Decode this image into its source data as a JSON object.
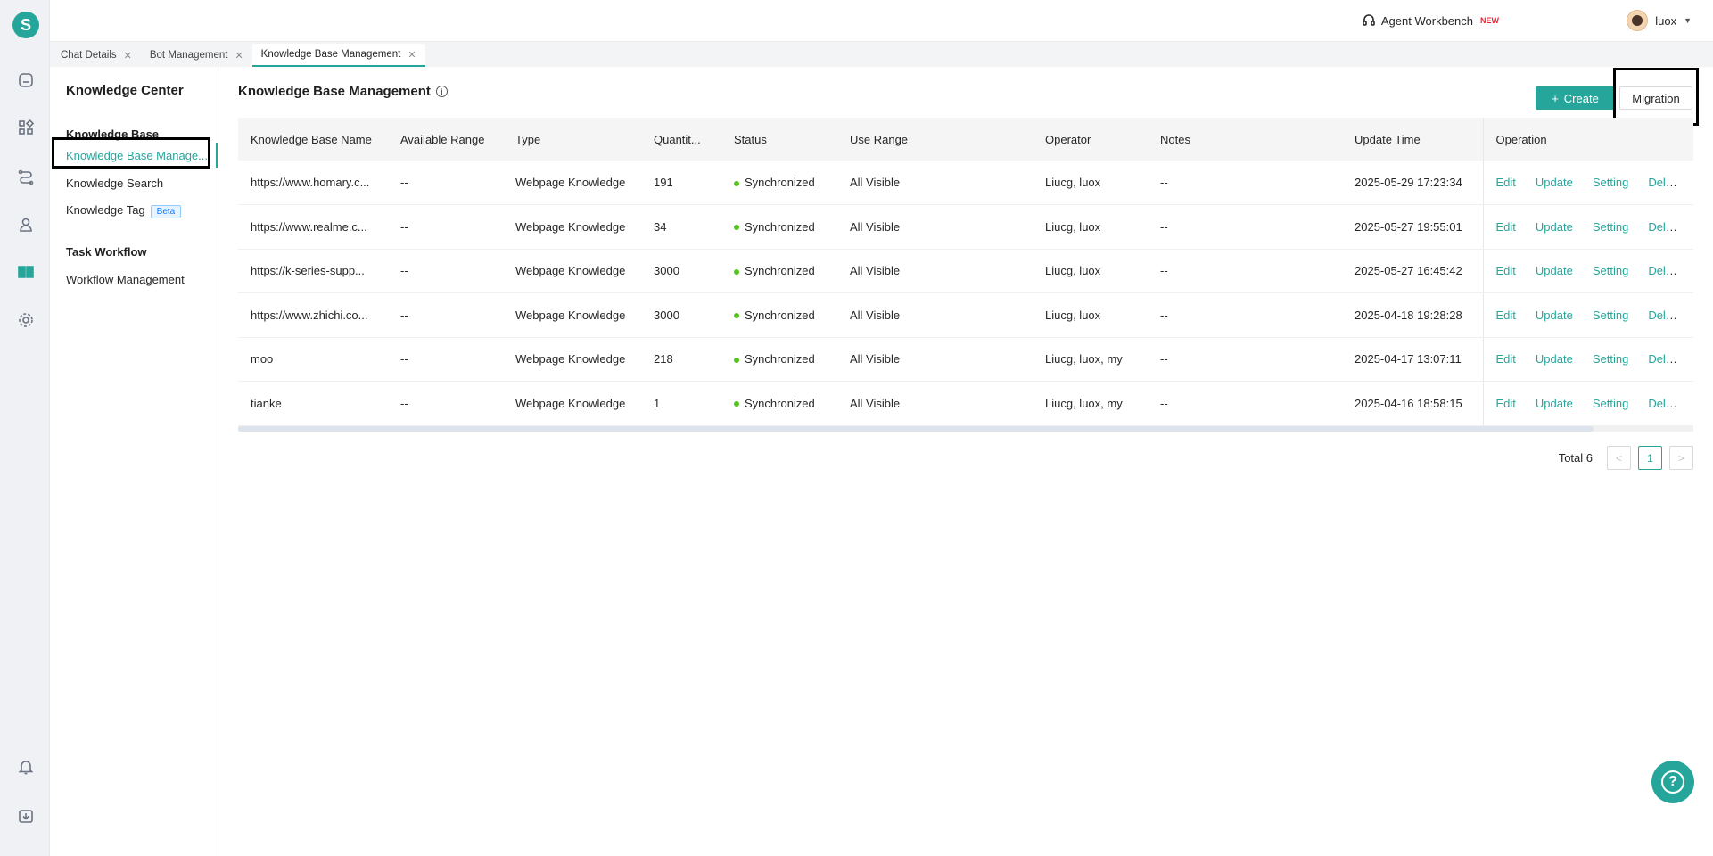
{
  "app": {
    "logo_letter": "S"
  },
  "header": {
    "agent_label": "Agent Workbench",
    "agent_badge": "NEW",
    "user_name": "luox"
  },
  "tabs": [
    {
      "label": "Chat Details"
    },
    {
      "label": "Bot Management"
    },
    {
      "label": "Knowledge Base Management"
    }
  ],
  "sidebar": {
    "title": "Knowledge Center",
    "group1": "Knowledge Base",
    "item1": "Knowledge Base Manage...",
    "item2": "Knowledge Search",
    "item3": "Knowledge Tag",
    "item3_badge": "Beta",
    "group2": "Task Workflow",
    "item4": "Workflow Management"
  },
  "main": {
    "title": "Knowledge Base Management",
    "create_label": "Create",
    "migration_label": "Migration",
    "columns": [
      "Knowledge Base Name",
      "Available Range",
      "Type",
      "Quantit...",
      "Status",
      "Use Range",
      "Operator",
      "Notes",
      "Update Time",
      "Operation"
    ],
    "rows": [
      {
        "name": "https://www.homary.c...",
        "range": "--",
        "type": "Webpage Knowledge",
        "qty": "191",
        "status": "Synchronized",
        "use": "All Visible",
        "operator": "Liucg, luox",
        "notes": "--",
        "time": "2025-05-29 17:23:34"
      },
      {
        "name": "https://www.realme.c...",
        "range": "--",
        "type": "Webpage Knowledge",
        "qty": "34",
        "status": "Synchronized",
        "use": "All Visible",
        "operator": "Liucg, luox",
        "notes": "--",
        "time": "2025-05-27 19:55:01"
      },
      {
        "name": "https://k-series-supp...",
        "range": "--",
        "type": "Webpage Knowledge",
        "qty": "3000",
        "status": "Synchronized",
        "use": "All Visible",
        "operator": "Liucg, luox",
        "notes": "--",
        "time": "2025-05-27 16:45:42"
      },
      {
        "name": "https://www.zhichi.co...",
        "range": "--",
        "type": "Webpage Knowledge",
        "qty": "3000",
        "status": "Synchronized",
        "use": "All Visible",
        "operator": "Liucg, luox",
        "notes": "--",
        "time": "2025-04-18 19:28:28"
      },
      {
        "name": "moo",
        "range": "--",
        "type": "Webpage Knowledge",
        "qty": "218",
        "status": "Synchronized",
        "use": "All Visible",
        "operator": "Liucg, luox, my",
        "notes": "--",
        "time": "2025-04-17 13:07:11"
      },
      {
        "name": "tianke",
        "range": "--",
        "type": "Webpage Knowledge",
        "qty": "1",
        "status": "Synchronized",
        "use": "All Visible",
        "operator": "Liucg, luox, my",
        "notes": "--",
        "time": "2025-04-16 18:58:15"
      }
    ],
    "operations": [
      "Edit",
      "Update",
      "Setting",
      "Delete"
    ],
    "total_label": "Total 6",
    "current_page": "1"
  },
  "colors": {
    "accent": "#26a69a",
    "status_ok": "#52c41a"
  },
  "icons": [
    "home-icon",
    "apps-icon",
    "flow-icon",
    "user-icon",
    "book-icon",
    "gear-icon",
    "bell-icon",
    "download-icon",
    "headset-icon",
    "help-icon"
  ]
}
